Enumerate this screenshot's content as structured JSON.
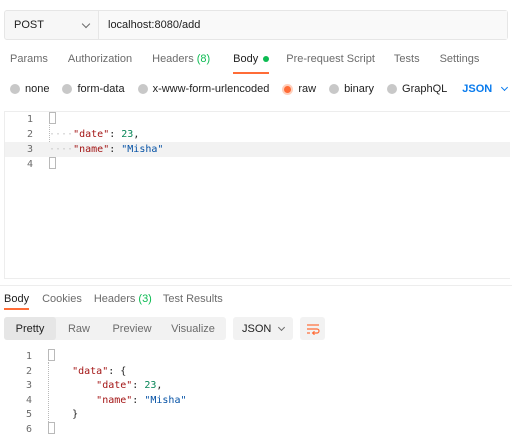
{
  "request": {
    "method": "POST",
    "url": "localhost:8080/add"
  },
  "request_tabs": [
    {
      "label": "Params",
      "count": ""
    },
    {
      "label": "Authorization",
      "count": ""
    },
    {
      "label": "Headers",
      "count": "(8)"
    },
    {
      "label": "Body",
      "count": ""
    },
    {
      "label": "Pre-request Script",
      "count": ""
    },
    {
      "label": "Tests",
      "count": ""
    },
    {
      "label": "Settings",
      "count": ""
    }
  ],
  "active_request_tab": "Body",
  "body_types": [
    "none",
    "form-data",
    "x-www-form-urlencoded",
    "raw",
    "binary",
    "GraphQL"
  ],
  "selected_body_type": "raw",
  "body_format": "JSON",
  "request_body_lines": [
    {
      "num": "1",
      "text": "{"
    },
    {
      "num": "2",
      "text": "    \"date\": 23,"
    },
    {
      "num": "3",
      "text": "    \"name\": \"Misha\""
    },
    {
      "num": "4",
      "text": "}"
    }
  ],
  "response_tabs": [
    {
      "label": "Body",
      "count": ""
    },
    {
      "label": "Cookies",
      "count": ""
    },
    {
      "label": "Headers",
      "count": "(3)"
    },
    {
      "label": "Test Results",
      "count": ""
    }
  ],
  "active_response_tab": "Body",
  "response_views": [
    "Pretty",
    "Raw",
    "Preview",
    "Visualize"
  ],
  "active_response_view": "Pretty",
  "response_format": "JSON",
  "response_body_lines": [
    {
      "num": "1",
      "text": "{"
    },
    {
      "num": "2",
      "text": "    \"data\": {"
    },
    {
      "num": "3",
      "text": "        \"date\": 23,"
    },
    {
      "num": "4",
      "text": "        \"name\": \"Misha\""
    },
    {
      "num": "5",
      "text": "    }"
    },
    {
      "num": "6",
      "text": "}"
    }
  ],
  "colors": {
    "accent": "#ff6c37",
    "count_green": "#0cbb52",
    "json_blue": "#097bed"
  },
  "icons": {
    "wrap": "wrap-lines-icon",
    "method_dropdown": "chevron-down-icon"
  }
}
